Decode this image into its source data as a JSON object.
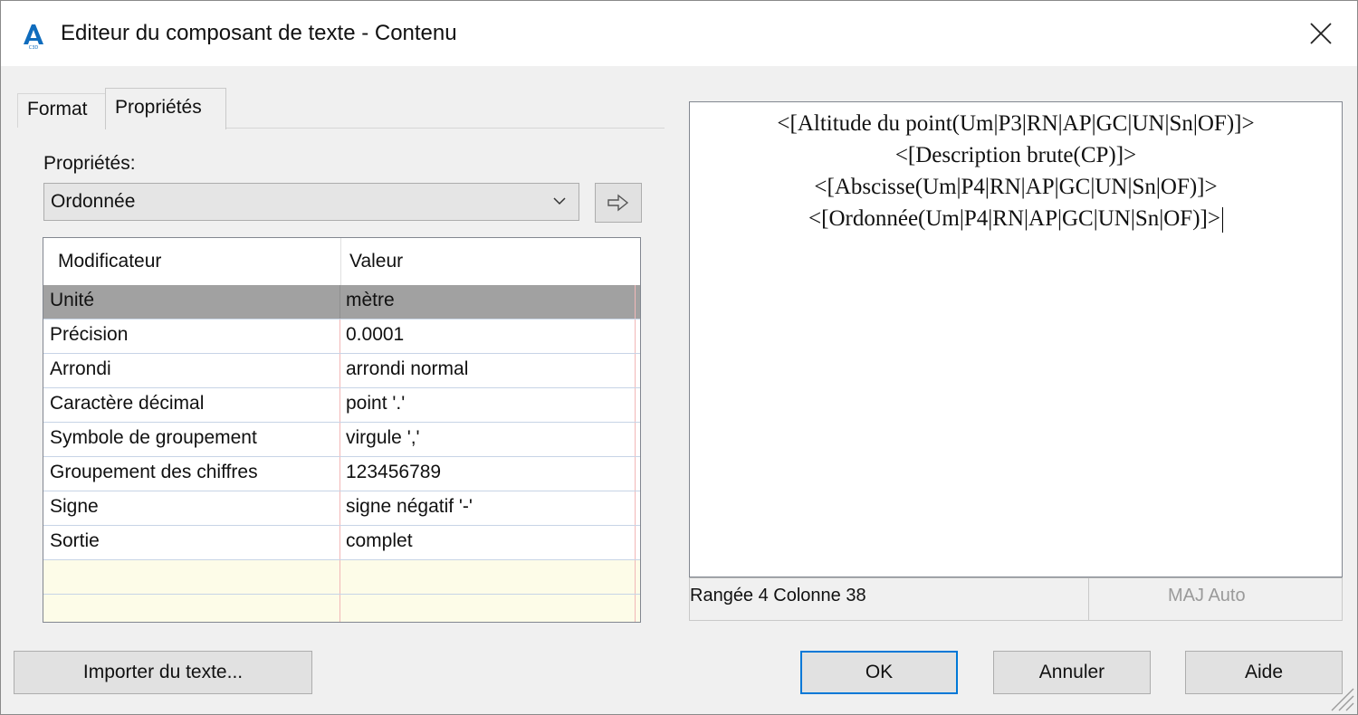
{
  "window": {
    "title": "Editeur du composant de texte - Contenu",
    "app_icon": "autocad-civil3d-icon",
    "close_icon": "close-icon"
  },
  "tabs": [
    {
      "label": "Format",
      "active": false
    },
    {
      "label": "Propriétés",
      "active": true
    }
  ],
  "properties": {
    "label": "Propriétés:",
    "selected": "Ordonnée",
    "dropdown_icon": "chevron-down-icon",
    "insert_icon": "arrow-right-icon"
  },
  "grid": {
    "headers": [
      "Modificateur",
      "Valeur"
    ],
    "rows": [
      {
        "modifier": "Unité",
        "value": "mètre",
        "selected": true
      },
      {
        "modifier": "Précision",
        "value": "0.0001"
      },
      {
        "modifier": "Arrondi",
        "value": "arrondi normal"
      },
      {
        "modifier": "Caractère décimal",
        "value": "point '.'"
      },
      {
        "modifier": "Symbole de groupement",
        "value": "virgule ','"
      },
      {
        "modifier": "Groupement des chiffres",
        "value": "123456789"
      },
      {
        "modifier": "Signe",
        "value": "signe négatif '-'"
      },
      {
        "modifier": "Sortie",
        "value": "complet"
      },
      {
        "modifier": "",
        "value": ""
      },
      {
        "modifier": "",
        "value": ""
      }
    ]
  },
  "editor": {
    "lines": [
      "<[Altitude du point(Um|P3|RN|AP|GC|UN|Sn|OF)]>",
      "<[Description brute(CP)]>",
      "<[Abscisse(Um|P4|RN|AP|GC|UN|Sn|OF)]>",
      "<[Ordonnée(Um|P4|RN|AP|GC|UN|Sn|OF)]>"
    ],
    "status_position": "Rangée 4 Colonne 38",
    "status_caps": "MAJ Auto"
  },
  "buttons": {
    "import": "Importer du texte...",
    "ok": "OK",
    "cancel": "Annuler",
    "help": "Aide"
  },
  "colors": {
    "accent": "#0078d7",
    "selected_row": "#a1a1a1",
    "empty_row": "#fdfce8"
  }
}
